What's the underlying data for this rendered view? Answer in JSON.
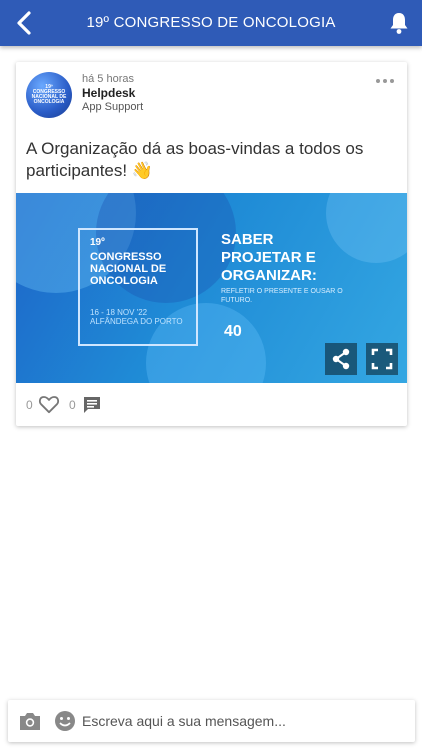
{
  "header": {
    "title": "19º CONGRESSO DE ONCOLOGIA",
    "back_icon": "chevron-left-icon",
    "notification_icon": "bell-icon"
  },
  "post": {
    "time": "há 5 horas",
    "author": "Helpdesk",
    "role": "App Support",
    "avatar_text": "19º CONGRESSO NACIONAL DE ONCOLOGIA",
    "text": "A Organização dá as boas-vindas a todos os participantes! 👋",
    "banner": {
      "number": "19º",
      "name": "CONGRESSO NACIONAL DE ONCOLOGIA",
      "dates": "16 - 18 NOV '22 ALFÂNDEGA DO PORTO",
      "slogan": "SABER PROJETAR E ORGANIZAR:",
      "slogan_sub": "REFLETIR O PRESENTE E OUSAR O FUTURO.",
      "anniversary": "40"
    },
    "likes": "0",
    "comments": "0"
  },
  "composer": {
    "placeholder": "Escreva aqui a sua mensagem..."
  },
  "colors": {
    "header_bg": "#2f5bb7",
    "icon_gray": "#777777"
  }
}
